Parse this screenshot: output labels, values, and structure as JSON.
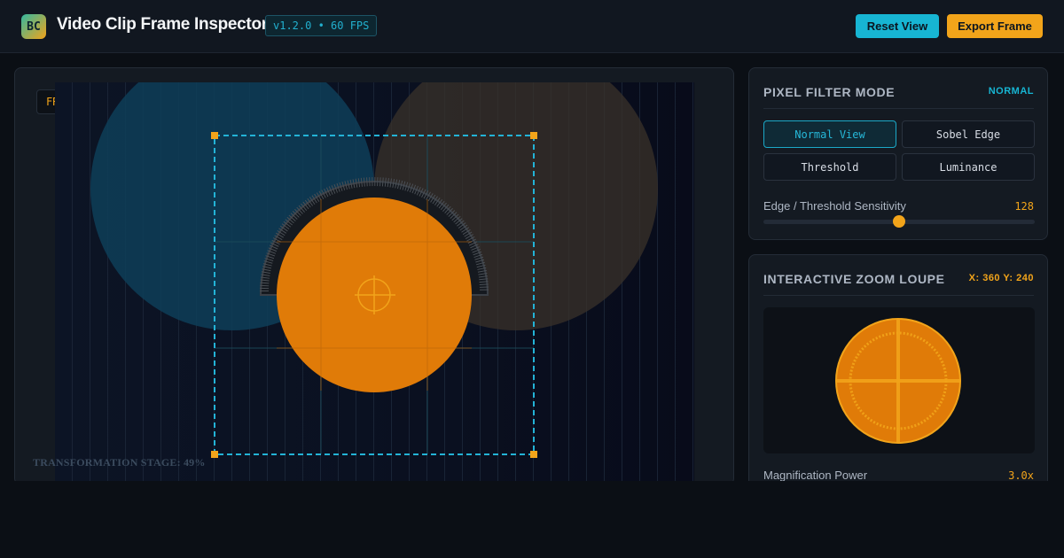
{
  "header": {
    "logo_text": "BC",
    "title": "Video Clip Frame Inspector",
    "version": "v1.2.0 • 60 FPS",
    "reset_label": "Reset View",
    "export_label": "Export Frame"
  },
  "stage": {
    "chip_text": "FR",
    "stage_label": "TRANSFORMATION STAGE: 49%",
    "transformation_progress": 0.49
  },
  "filter_panel": {
    "title": "PIXEL FILTER MODE",
    "mode_tag": "NORMAL",
    "modes": [
      "Normal View",
      "Sobel Edge",
      "Threshold",
      "Luminance"
    ],
    "active_mode": "Normal View",
    "sensitivity_label": "Edge / Threshold Sensitivity",
    "sensitivity_value": "128",
    "sensitivity_fraction": 0.5
  },
  "zoom_panel": {
    "title": "INTERACTIVE ZOOM LOUPE",
    "coords": "X: 360 Y: 240",
    "magnification_label": "Magnification Power",
    "magnification_value": "3.0x"
  },
  "colors": {
    "accent_cyan": "#17b5d3",
    "accent_orange": "#f2a41a",
    "background": "#0b0f15",
    "panel": "#141a22"
  },
  "icons": {
    "crosshair": "crosshair-icon"
  }
}
